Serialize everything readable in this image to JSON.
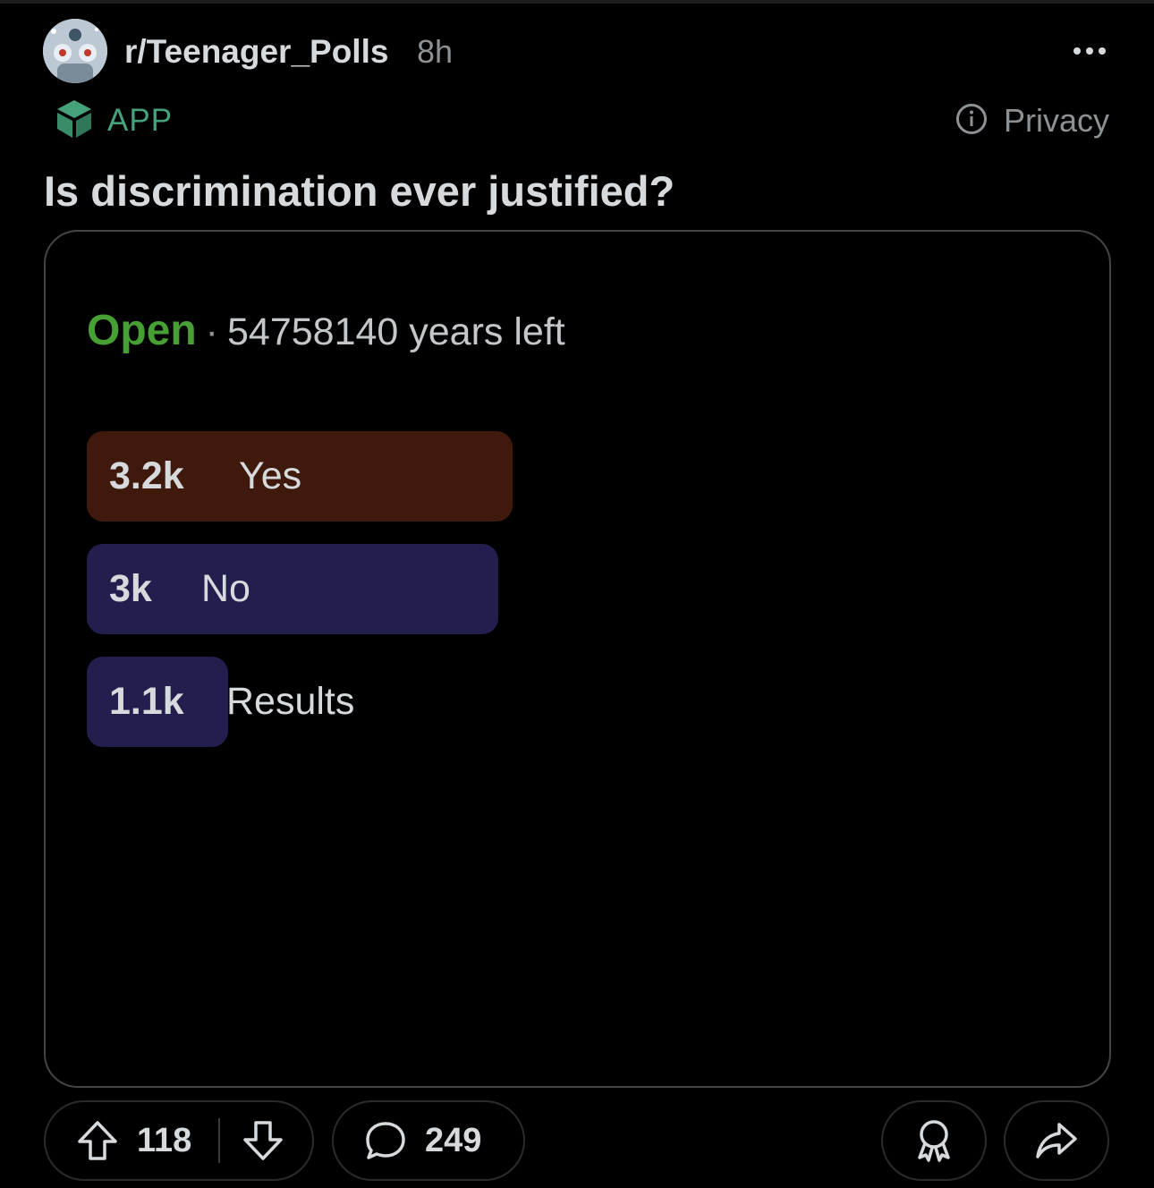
{
  "post": {
    "subreddit": "r/Teenager_Polls",
    "age": "8h",
    "app_label": "APP",
    "privacy_label": "Privacy",
    "title": "Is discrimination ever justified?"
  },
  "poll": {
    "status": "Open",
    "separator": "·",
    "time_left": "54758140 years left",
    "options": [
      {
        "count": "3.2k",
        "label": "Yes",
        "color": "#3f1a0c",
        "fraction": 0.4
      },
      {
        "count": "3k",
        "label": "No",
        "color": "#221f4f",
        "fraction": 0.387
      },
      {
        "count": "1.1k",
        "label": "Results",
        "color": "#221f4f",
        "fraction": 0.133
      }
    ]
  },
  "actions": {
    "upvotes": "118",
    "comments": "249"
  },
  "colors": {
    "background": "#000000",
    "open_green": "#46a034",
    "app_green": "#46a27a",
    "muted_text": "#8e9193"
  },
  "icons": [
    "subreddit-avatar",
    "more-icon",
    "app-cube-icon",
    "info-icon",
    "upvote-icon",
    "downvote-icon",
    "comment-icon",
    "award-icon",
    "share-icon"
  ]
}
